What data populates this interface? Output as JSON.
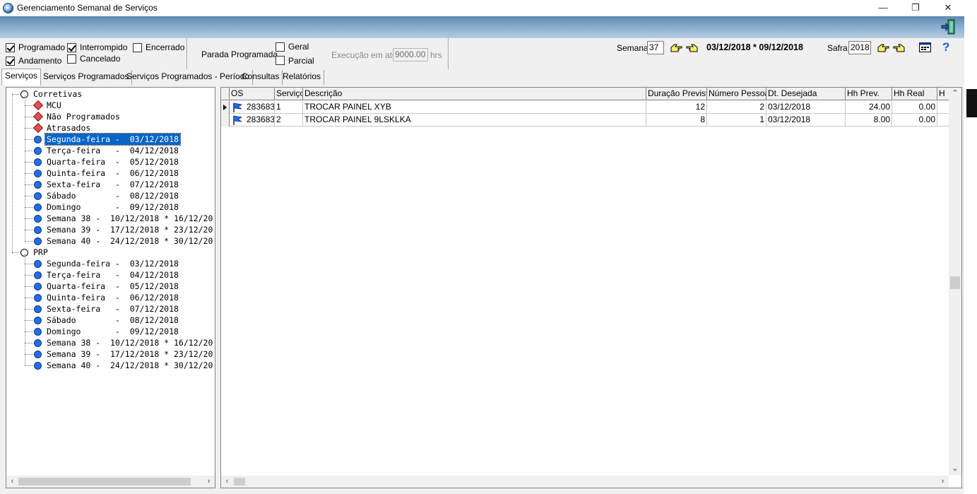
{
  "window": {
    "title": "Gerenciamento Semanal de Serviços",
    "minimize": "—",
    "restore": "❐",
    "close": "✕"
  },
  "filters": {
    "programado": {
      "label": "Programado",
      "checked": true
    },
    "interrompido": {
      "label": "Interrompido",
      "checked": true
    },
    "encerrado": {
      "label": "Encerrado",
      "checked": false
    },
    "andamento": {
      "label": "Andamento",
      "checked": true
    },
    "cancelado": {
      "label": "Cancelado",
      "checked": false
    }
  },
  "parada": {
    "label": "Parada Programada",
    "geral": {
      "label": "Geral",
      "checked": false
    },
    "parcial": {
      "label": "Parcial",
      "checked": false
    },
    "execucao_label": "Execução em até",
    "execucao_value": "9000.00",
    "execucao_unit": "hrs"
  },
  "semana": {
    "label": "Semana",
    "value": "37",
    "range": "03/12/2018 * 09/12/2018"
  },
  "safra": {
    "label": "Safra",
    "value": "2018"
  },
  "tabs": [
    {
      "label": "Serviços",
      "active": true
    },
    {
      "label": "Serviços Programados",
      "active": false
    },
    {
      "label": "Serviços Programados - Período",
      "active": false
    },
    {
      "label": "Consultas",
      "active": false
    },
    {
      "label": "Relatórios",
      "active": false
    }
  ],
  "tree": {
    "corretivas": {
      "label": "Corretivas",
      "items": [
        {
          "label": "MCU",
          "icon": "diamond"
        },
        {
          "label": "Não Programados",
          "icon": "diamond"
        },
        {
          "label": "Atrasados",
          "icon": "diamond"
        },
        {
          "label": "Segunda-feira -  03/12/2018",
          "icon": "circle",
          "selected": true
        },
        {
          "label": "Terça-feira   -  04/12/2018",
          "icon": "circle"
        },
        {
          "label": "Quarta-feira  -  05/12/2018",
          "icon": "circle"
        },
        {
          "label": "Quinta-feira  -  06/12/2018",
          "icon": "circle"
        },
        {
          "label": "Sexta-feira   -  07/12/2018",
          "icon": "circle"
        },
        {
          "label": "Sábado        -  08/12/2018",
          "icon": "circle"
        },
        {
          "label": "Domingo       -  09/12/2018",
          "icon": "circle"
        },
        {
          "label": "Semana 38 -  10/12/2018 * 16/12/20",
          "icon": "circle"
        },
        {
          "label": "Semana 39 -  17/12/2018 * 23/12/20",
          "icon": "circle"
        },
        {
          "label": "Semana 40 -  24/12/2018 * 30/12/20",
          "icon": "circle"
        }
      ]
    },
    "prp": {
      "label": "PRP",
      "items": [
        {
          "label": "Segunda-feira -  03/12/2018",
          "icon": "circle"
        },
        {
          "label": "Terça-feira   -  04/12/2018",
          "icon": "circle"
        },
        {
          "label": "Quarta-feira  -  05/12/2018",
          "icon": "circle"
        },
        {
          "label": "Quinta-feira  -  06/12/2018",
          "icon": "circle"
        },
        {
          "label": "Sexta-feira   -  07/12/2018",
          "icon": "circle"
        },
        {
          "label": "Sábado        -  08/12/2018",
          "icon": "circle"
        },
        {
          "label": "Domingo       -  09/12/2018",
          "icon": "circle"
        },
        {
          "label": "Semana 38 -  10/12/2018 * 16/12/20",
          "icon": "circle"
        },
        {
          "label": "Semana 39 -  17/12/2018 * 23/12/20",
          "icon": "circle"
        },
        {
          "label": "Semana 40 -  24/12/2018 * 30/12/20",
          "icon": "circle"
        }
      ]
    }
  },
  "grid": {
    "columns": [
      "OS",
      "Serviço",
      "Descrição",
      "Duração Prevista",
      "Número Pessoas",
      "Dt. Desejada",
      "Hh Prev.",
      "Hh Real",
      "H"
    ],
    "rows": [
      [
        "283683",
        "1",
        "TROCAR PAINEL XYB",
        "12",
        "2",
        "03/12/2018",
        "24.00",
        "0.00"
      ],
      [
        "283683",
        "2",
        "TROCAR PAINEL 9LSKLKA",
        "8",
        "1",
        "03/12/2018",
        "8.00",
        "0.00"
      ]
    ]
  },
  "colors": {
    "banner": "#8fb2d2",
    "selection": "#0a64c8",
    "node_blue": "#1f6fe8",
    "node_red": "#e05050"
  }
}
